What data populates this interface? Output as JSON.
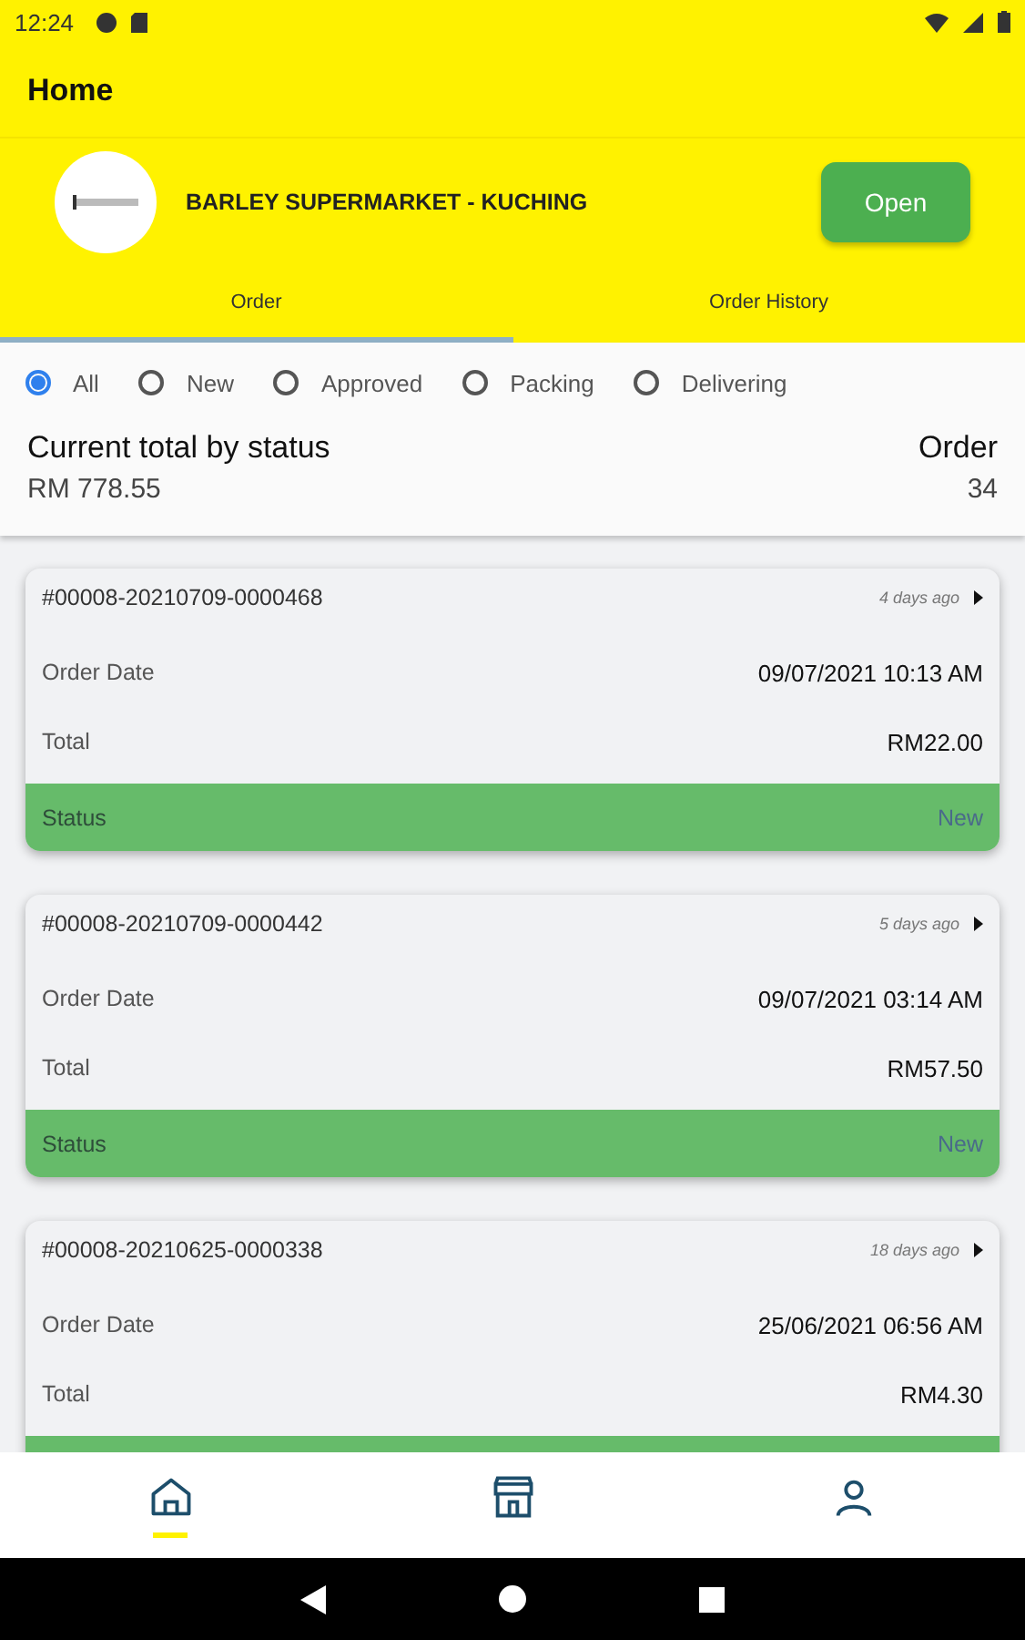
{
  "status_bar": {
    "time": "12:24"
  },
  "header": {
    "title": "Home"
  },
  "store": {
    "name": "BARLEY SUPERMARKET - KUCHING",
    "button": "Open"
  },
  "tabs": [
    {
      "label": "Order",
      "selected": true
    },
    {
      "label": "Order History",
      "selected": false
    }
  ],
  "filters": [
    {
      "label": "All",
      "selected": true
    },
    {
      "label": "New",
      "selected": false
    },
    {
      "label": "Approved",
      "selected": false
    },
    {
      "label": "Packing",
      "selected": false
    },
    {
      "label": "Delivering",
      "selected": false
    }
  ],
  "summary": {
    "title": "Current total by status",
    "amount": "RM 778.55",
    "order_label": "Order",
    "order_count": "34"
  },
  "orders": [
    {
      "number": "#00008-20210709-0000468",
      "age": "4 days ago",
      "date_label": "Order Date",
      "date": "09/07/2021 10:13 AM",
      "total_label": "Total",
      "total": "RM22.00",
      "status_label": "Status",
      "status": "New"
    },
    {
      "number": "#00008-20210709-0000442",
      "age": "5 days ago",
      "date_label": "Order Date",
      "date": "09/07/2021 03:14 AM",
      "total_label": "Total",
      "total": "RM57.50",
      "status_label": "Status",
      "status": "New"
    },
    {
      "number": "#00008-20210625-0000338",
      "age": "18 days ago",
      "date_label": "Order Date",
      "date": "25/06/2021 06:56 AM",
      "total_label": "Total",
      "total": "RM4.30"
    }
  ],
  "bottom_nav": [
    {
      "kind": "home",
      "selected": true
    },
    {
      "kind": "store",
      "selected": false
    },
    {
      "kind": "profile",
      "selected": false
    }
  ]
}
